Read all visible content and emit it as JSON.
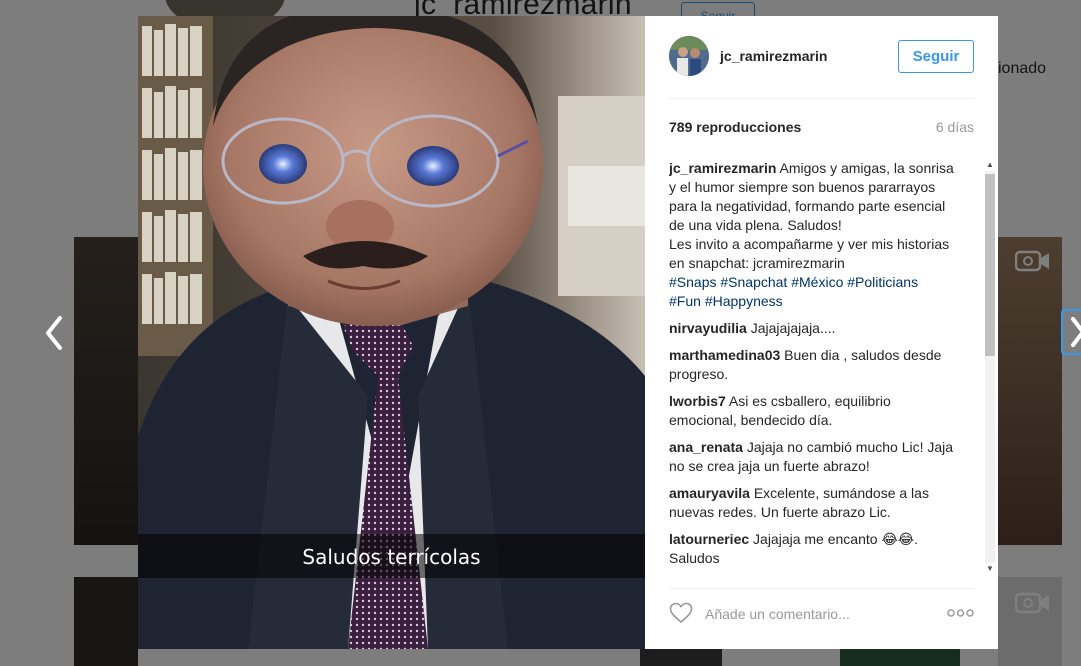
{
  "background": {
    "profile_name": "jc_ramirezmarin",
    "follow_label": "Seguir",
    "side_text": "sionado"
  },
  "post": {
    "username": "jc_ramirezmarin",
    "follow_label": "Seguir",
    "views": "789 reproducciones",
    "time": "6 días",
    "video_caption": "Saludos terrícolas",
    "caption_user": "jc_ramirezmarin",
    "caption_text": " Amigos y amigas, la sonrisa y el humor siempre son buenos pararrayos para la negatividad, formando parte esencial de una vida plena. Saludos!",
    "caption_text_2": "Les invito a acompañarme y ver mis historias en snapchat: jcramirezmarin",
    "hashtags": [
      "#Snaps",
      "#Snapchat",
      "#México",
      "#Politicians",
      "#Fun",
      "#Happyness"
    ],
    "comment_placeholder": "Añade un comentario..."
  },
  "comments": [
    {
      "user": "nirvayudilia",
      "text": " Jajajajajaja...."
    },
    {
      "user": "marthamedina03",
      "text": " Buen dia , saludos desde progreso."
    },
    {
      "user": "lworbis7",
      "text": " Asi es csballero, equilibrio emocional, bendecido día."
    },
    {
      "user": "ana_renata",
      "text": " Jajaja no cambió mucho Lic! Jaja no se crea jaja un fuerte abrazo!"
    },
    {
      "user": "amauryavila",
      "text": " Excelente, sumándose a las nuevas redes. Un fuerte abrazo Lic."
    },
    {
      "user": "latourneriec",
      "text": " Jajajaja me encanto 😂😂. Saludos"
    }
  ],
  "icons": {
    "prev": "chevron-left-icon",
    "next": "chevron-right-icon",
    "like": "heart-icon",
    "more": "more-options-icon",
    "video": "video-camera-icon"
  },
  "colors": {
    "accent": "#3897f0",
    "hashtag": "#003569",
    "muted": "#999999"
  }
}
